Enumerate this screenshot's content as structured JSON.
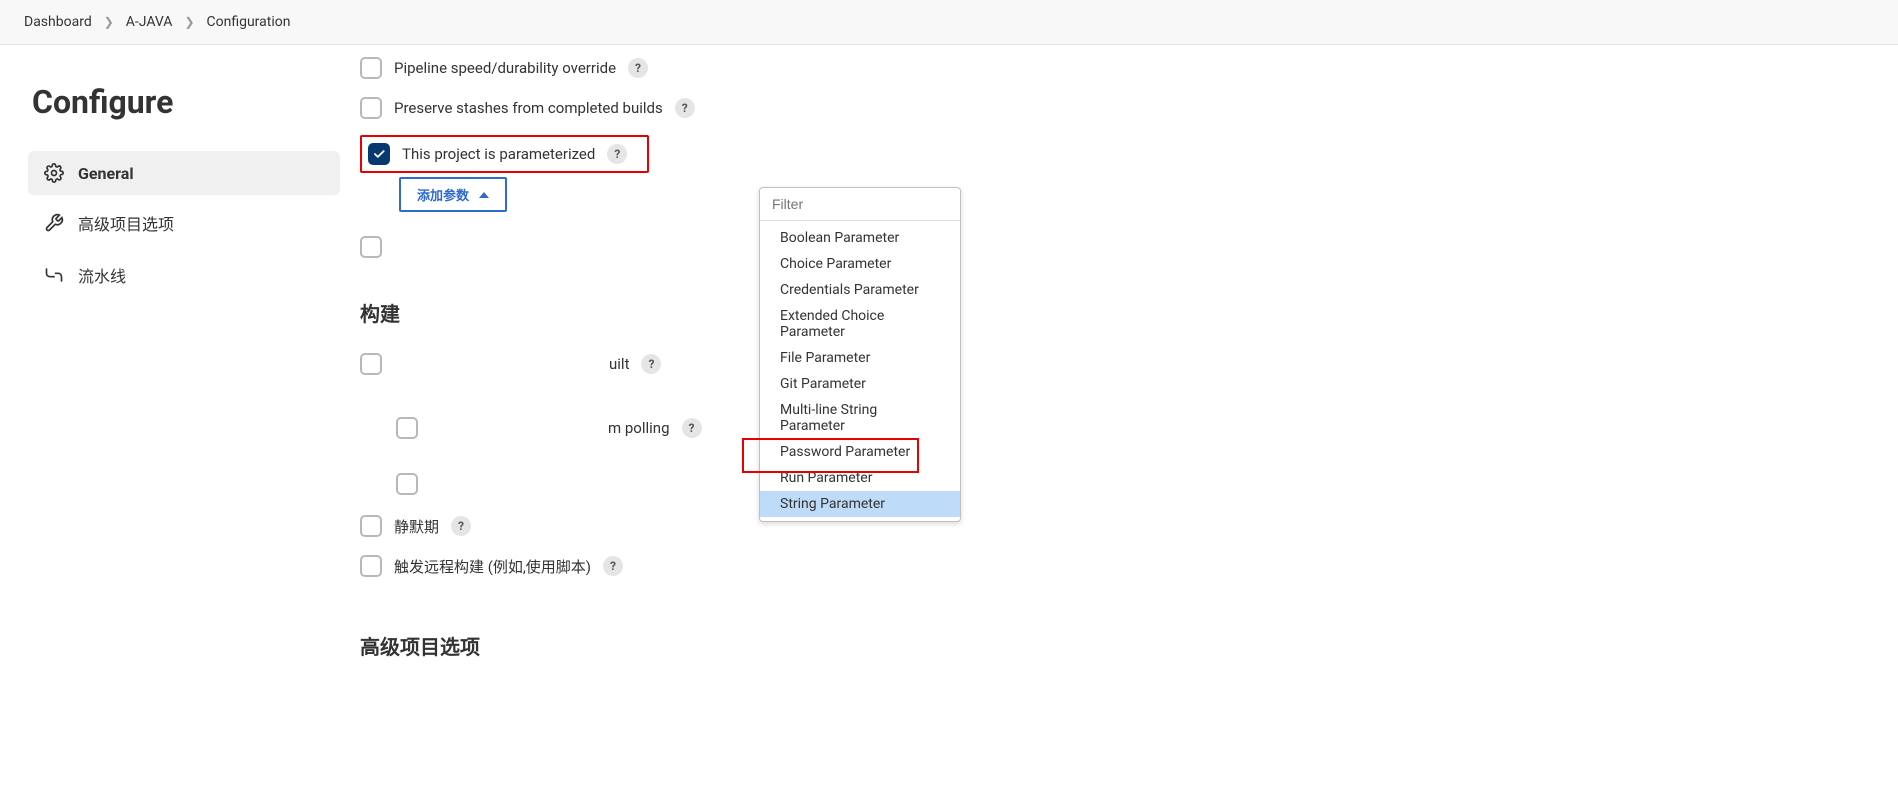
{
  "breadcrumb": {
    "items": [
      "Dashboard",
      "A-JAVA",
      "Configuration"
    ]
  },
  "page_title": "Configure",
  "sidebar": {
    "items": [
      {
        "label": "General",
        "active": true,
        "icon": "gear"
      },
      {
        "label": "高级项目选项",
        "active": false,
        "icon": "wrench"
      },
      {
        "label": "流水线",
        "active": false,
        "icon": "pipeline"
      }
    ]
  },
  "options": {
    "pipeline_speed": "Pipeline speed/durability override",
    "preserve_stashes": "Preserve stashes from completed builds",
    "parameterized": "This project is parameterized",
    "concurrent_suffix": "uilt",
    "throttle_suffix": "m polling",
    "silent_period": "静默期",
    "remote_trigger": "触发远程构建 (例如,使用脚本)"
  },
  "add_param_button": "添加参数",
  "dropdown": {
    "filter_placeholder": "Filter",
    "items": [
      "Boolean Parameter",
      "Choice Parameter",
      "Credentials Parameter",
      "Extended Choice Parameter",
      "File Parameter",
      "Git Parameter",
      "Multi-line String Parameter",
      "Password Parameter",
      "Run Parameter",
      "String Parameter"
    ],
    "hovered_index": 9
  },
  "sections": {
    "build": "构建",
    "advanced": "高级项目选项"
  },
  "help_char": "?"
}
